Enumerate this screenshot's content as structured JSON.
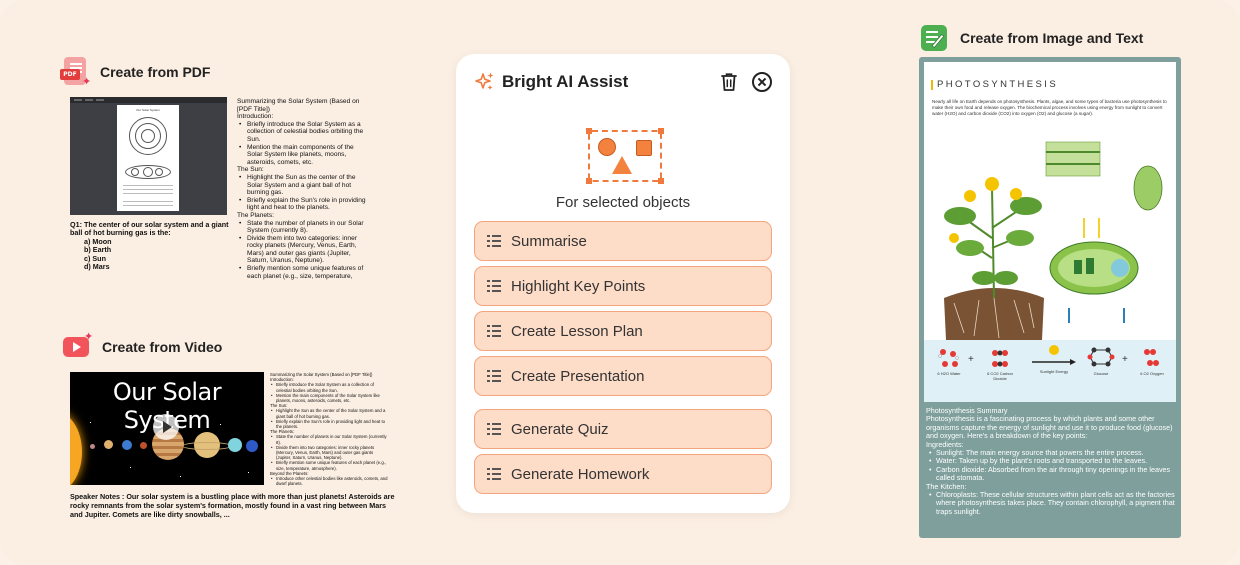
{
  "sections": {
    "pdf": {
      "title": "Create from PDF",
      "icon": "pdf-file-icon",
      "icon_tag": "PDF",
      "page_title": "Our Solar System",
      "summary_title": "Summarizing the Solar System (Based on [PDF Title])",
      "summary_groups": [
        {
          "heading": "Introduction:",
          "items": [
            "Briefly introduce the Solar System as a collection of celestial bodies orbiting the Sun.",
            "Mention the main components of the Solar System like planets, moons, asteroids, comets, etc."
          ]
        },
        {
          "heading": "The Sun:",
          "items": [
            "Highlight the Sun as the center of the Solar System and a giant ball of hot burning gas.",
            "Briefly explain the Sun's role in providing light and heat to the planets."
          ]
        },
        {
          "heading": "The Planets:",
          "items": [
            "State the number of planets in our Solar System (currently 8).",
            "Divide them into two categories: inner rocky planets (Mercury, Venus, Earth, Mars) and outer gas giants (Jupiter, Saturn, Uranus, Neptune).",
            "Briefly mention some unique features of each planet (e.g., size, temperature,"
          ]
        }
      ],
      "question": "Q1: The center of our solar system and a giant ball of hot burning gas is the:",
      "options": [
        "a) Moon",
        "b) Earth",
        "c) Sun",
        "d) Mars"
      ]
    },
    "video": {
      "title": "Create from Video",
      "icon": "video-play-icon",
      "video_title": "Our Solar System",
      "summary_title": "Summarizing the Solar System (Based on [PDF Title])",
      "summary_groups": [
        {
          "heading": "Introduction:",
          "items": [
            "Briefly introduce the Solar System as a collection of celestial bodies orbiting the Sun.",
            "Mention the main components of the Solar System like planets, moons, asteroids, comets, etc."
          ]
        },
        {
          "heading": "The Sun:",
          "items": [
            "Highlight the Sun as the center of the Solar System and a giant ball of hot burning gas.",
            "Briefly explain the Sun's role in providing light and heat to the planets."
          ]
        },
        {
          "heading": "The Planets:",
          "items": [
            "State the number of planets in our Solar System (currently 8).",
            "Divide them into two categories: inner rocky planets (Mercury, Venus, Earth, Mars) and outer gas giants (Jupiter, Saturn, Uranus, Neptune).",
            "Briefly mention some unique features of each planet (e.g., size, temperature, atmosphere)."
          ]
        },
        {
          "heading": "Beyond the Planets:",
          "items": [
            "Introduce other celestial bodies like asteroids, comets, and dwarf planets."
          ]
        }
      ],
      "speaker_notes": "Speaker Notes :  Our solar system is a bustling place with more than just planets!  Asteroids are rocky remnants from the solar system's formation, mostly found in a vast ring between Mars and Jupiter.  Comets are like dirty snowballs, ..."
    },
    "image_text": {
      "title": "Create from Image and Text",
      "icon": "image-edit-icon",
      "poster_title": "PHOTOSYNTHESIS",
      "poster_intro": "Nearly all life on Earth depends on photosynthesis. Plants, algae, and some types of bacteria use photosynthesis to make their own food and release oxygen. The biochemical process involves using energy from sunlight to convert water (H2O) and carbon dioxide (CO2) into oxygen (O2) and glucose (a sugar).",
      "equation": {
        "water": "6 H2O Water",
        "co2": "6 CO2 Carbon Dioxide",
        "energy": "Sunlight Energy",
        "glucose": "Glucose",
        "oxygen": "6 O2 Oxygen",
        "plus": "+"
      },
      "summary_title": "Photosynthesis Summary",
      "summary_body": "Photosynthesis is a fascinating process by which plants and some other organisms capture the energy of sunlight and use it to produce food (glucose) and oxygen. Here's a breakdown of the key points:",
      "ingredients_heading": "Ingredients:",
      "ingredients": [
        "Sunlight: The main energy source that powers the entire process.",
        "Water: Taken up by the plant's roots and transported to the leaves.",
        "Carbon dioxide: Absorbed from the air through tiny openings in the leaves called stomata."
      ],
      "kitchen_heading": "The Kitchen:",
      "kitchen": [
        "Chloroplasts: These cellular structures within plant cells act as the factories where photosynthesis takes place. They contain chlorophyll, a pigment that traps sunlight."
      ]
    }
  },
  "assist_panel": {
    "title": "Bright AI Assist",
    "header_icon": "sparkle-icon",
    "delete_icon": "trash-icon",
    "close_icon": "close-circle-icon",
    "subtitle": "For selected objects",
    "actions": [
      "Summarise",
      "Highlight Key Points",
      "Create Lesson Plan",
      "Create Presentation",
      "Generate Quiz",
      "Generate Homework"
    ]
  },
  "colors": {
    "background": "#fbeee2",
    "button_fill": "#fddcc8",
    "button_border": "#f4a57e",
    "accent_orange": "#f07a3c",
    "image_card": "#7e9f9c"
  }
}
